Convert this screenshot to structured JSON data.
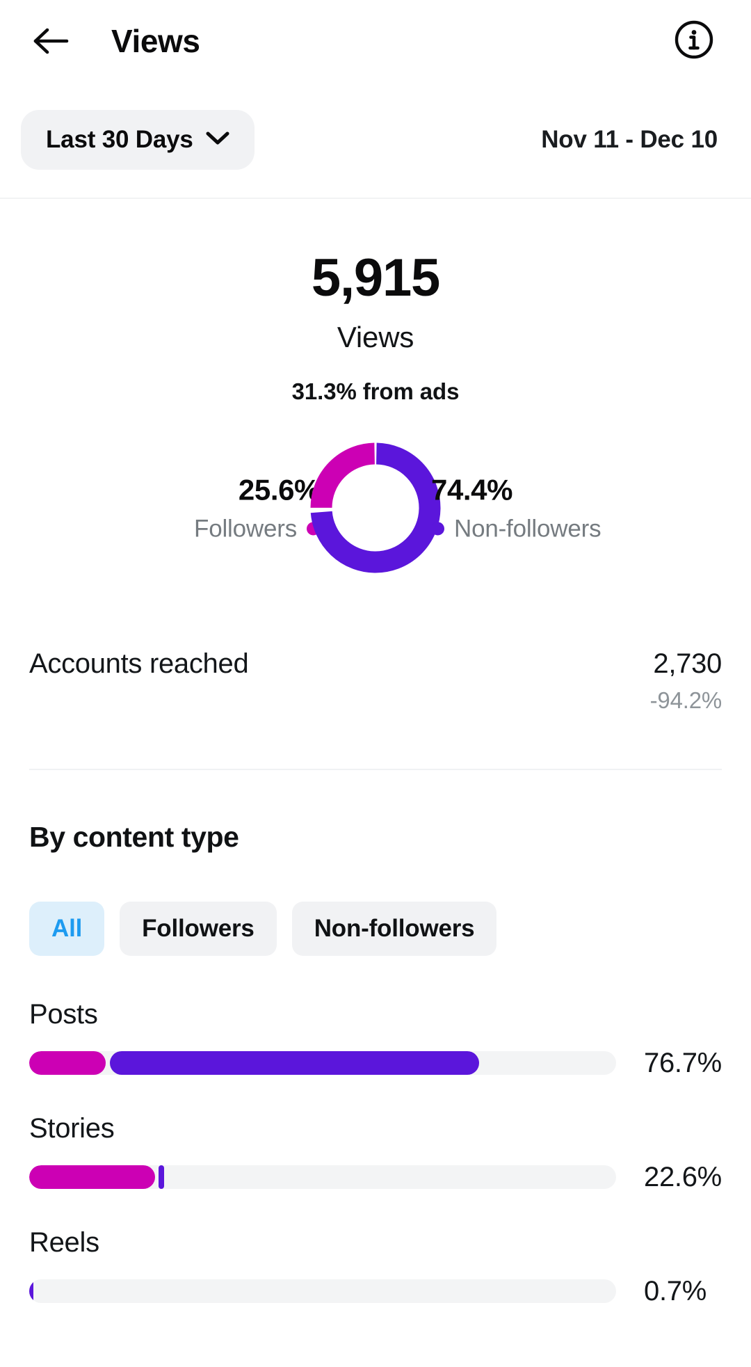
{
  "appbar": {
    "title": "Views",
    "back_icon": "arrow-left-icon",
    "info_icon": "info-circle-icon"
  },
  "range": {
    "preset_label": "Last 30 Days",
    "chevron_icon": "chevron-down-icon",
    "dates": "Nov 11 - Dec 10"
  },
  "summary": {
    "value": "5,915",
    "label": "Views",
    "ads_note": "31.3% from ads"
  },
  "donut": {
    "followers_pct_label": "25.6%",
    "followers_name": "Followers",
    "nonfollowers_pct_label": "74.4%",
    "nonfollowers_name": "Non-followers"
  },
  "metric": {
    "name": "Accounts reached",
    "value": "2,730",
    "delta": "-94.2%"
  },
  "section": {
    "title": "By content type"
  },
  "chips": [
    {
      "label": "All",
      "active": true
    },
    {
      "label": "Followers",
      "active": false
    },
    {
      "label": "Non-followers",
      "active": false
    }
  ],
  "bars": [
    {
      "label": "Posts",
      "pct_label": "76.7%"
    },
    {
      "label": "Stories",
      "pct_label": "22.6%"
    },
    {
      "label": "Reels",
      "pct_label": "0.7%"
    }
  ],
  "colors": {
    "followers": "#cc00b4",
    "nonfollowers": "#5b16db",
    "track": "#f3f4f5",
    "chip_active_bg": "#ddeffb",
    "chip_active_text": "#1d9bf0",
    "chip_bg": "#f1f2f4",
    "text_primary": "#101214",
    "text_muted": "#8e9499"
  },
  "chart_data": [
    {
      "type": "pie",
      "title": "Views by audience",
      "subtitle": "31.3% from ads",
      "total": 5915,
      "categories": [
        "Followers",
        "Non-followers"
      ],
      "values": [
        25.6,
        74.4
      ],
      "unit": "%",
      "colors": [
        "#cc00b4",
        "#5b16db"
      ],
      "legend": "sides",
      "donut": true,
      "start_angle_deg": 0,
      "followers_direction": "counter-clockwise"
    },
    {
      "type": "bar",
      "title": "By content type",
      "orientation": "horizontal",
      "stacked": true,
      "categories": [
        "Posts",
        "Stories",
        "Reels"
      ],
      "series": [
        {
          "name": "Followers",
          "color": "#cc00b4",
          "values": [
            13.0,
            21.6,
            0.0
          ]
        },
        {
          "name": "Non-followers",
          "color": "#5b16db",
          "values": [
            63.7,
            1.0,
            0.7
          ]
        }
      ],
      "totals": [
        76.7,
        22.6,
        0.7
      ],
      "total_labels": [
        "76.7%",
        "22.6%",
        "0.7%"
      ],
      "xlim": [
        0,
        100
      ],
      "unit": "%",
      "grid": false,
      "legend": "none"
    }
  ]
}
